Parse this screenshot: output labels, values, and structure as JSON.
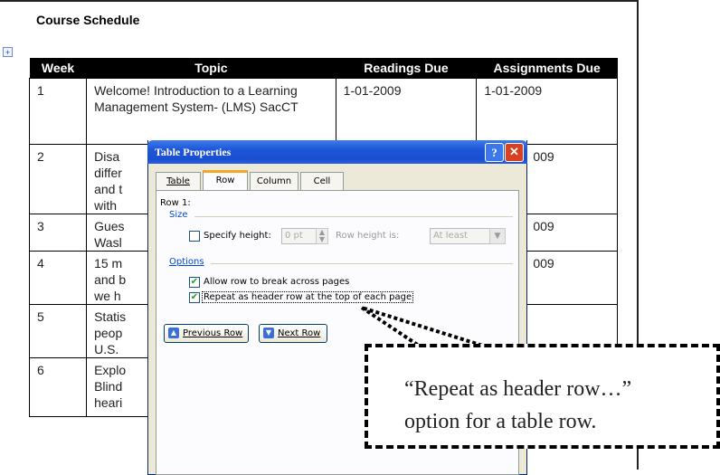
{
  "document": {
    "title": "Course Schedule",
    "move_handle": "+",
    "headers": [
      "Week",
      "Topic",
      "Readings Due",
      "Assignments Due"
    ],
    "rows": [
      {
        "week": "1",
        "topic": "Welcome!  Introduction to a Learning Management System- (LMS) SacCT",
        "readings": "1-01-2009",
        "assignments": "1-01-2009"
      },
      {
        "week": "2",
        "topic": "Disa\ndiffer\nand t\nwith",
        "readings": "",
        "assignments": "009"
      },
      {
        "week": "3",
        "topic": "Gues\nWasl",
        "readings": "",
        "assignments": "009"
      },
      {
        "week": "4",
        "topic": "15 m\nand b\nwe h",
        "readings": "",
        "assignments": "009"
      },
      {
        "week": "5",
        "topic": "Statis\npeop\nU.S.",
        "readings": "",
        "assignments": ""
      },
      {
        "week": "6",
        "topic": "Explo\nBlind\nheari",
        "readings": "",
        "assignments": ""
      }
    ]
  },
  "dialog": {
    "title": "Table Properties",
    "help_glyph": "?",
    "close_glyph": "✕",
    "tabs": [
      {
        "label": "Table"
      },
      {
        "label": "Row"
      },
      {
        "label": "Column"
      },
      {
        "label": "Cell"
      }
    ],
    "active_tab": "Row",
    "row_label": "Row 1:",
    "size_group": "Size",
    "specify_height_label": "Specify height:",
    "specify_height_checked": false,
    "height_value": "0 pt",
    "row_height_is_label": "Row height is:",
    "row_height_is_value": "At least",
    "options_group": "Options",
    "allow_break_label": "Allow row to break across pages",
    "allow_break_checked": true,
    "repeat_header_label": "Repeat as header row at the top of each page",
    "repeat_header_checked": true,
    "previous_row_label": "Previous Row",
    "next_row_label": "Next Row",
    "check_glyph": "✔",
    "up_glyph": "▲",
    "down_glyph": "▼"
  },
  "callout": {
    "line1": "“Repeat as header row…”",
    "line2": "option for a table row."
  }
}
